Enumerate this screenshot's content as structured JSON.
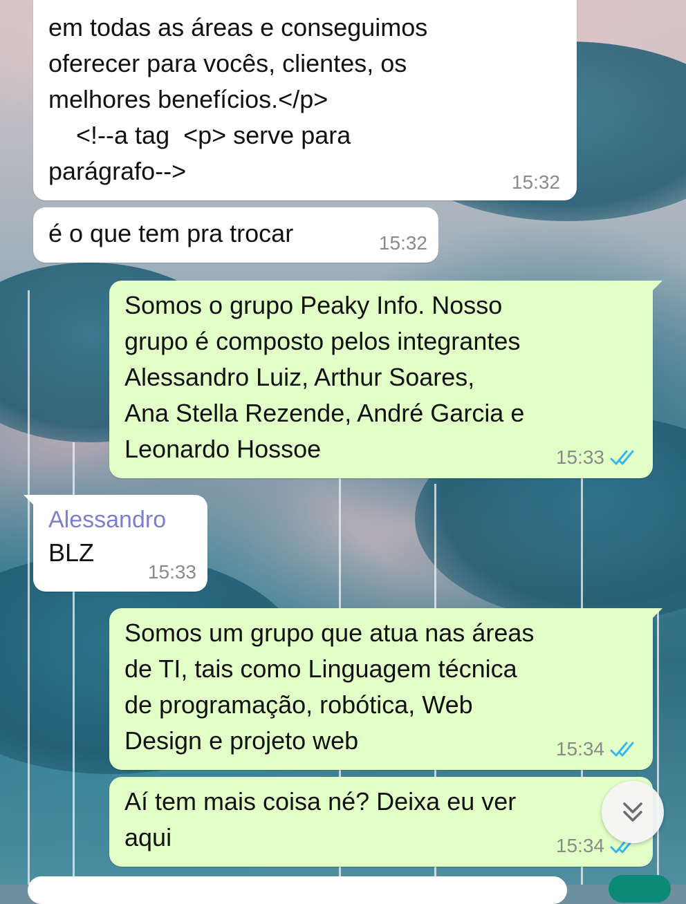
{
  "messages": [
    {
      "direction": "incoming",
      "text": "em todas as áreas e conseguimos\noferecer para vocês, clientes, os\nmelhores benefícios.</p>\n    <!--a tag  <p> serve para\nparágrafo-->",
      "time": "15:32"
    },
    {
      "direction": "incoming",
      "text": "é o que tem pra trocar",
      "time": "15:32"
    },
    {
      "direction": "outgoing",
      "text": "Somos o grupo Peaky Info. Nosso\ngrupo é composto pelos integrantes\nAlessandro Luiz, Arthur Soares,\nAna Stella Rezende, André Garcia e\nLeonardo Hossoe",
      "time": "15:33",
      "status": "read"
    },
    {
      "direction": "incoming",
      "sender": "Alessandro",
      "text": "BLZ",
      "time": "15:33"
    },
    {
      "direction": "outgoing",
      "text": "Somos um grupo que atua nas áreas\nde TI, tais como Linguagem técnica\nde programação, robótica, Web\nDesign e projeto web",
      "time": "15:34",
      "status": "read"
    },
    {
      "direction": "outgoing",
      "text": "Aí tem mais coisa né? Deixa eu ver\naqui",
      "time": "15:34",
      "status": "read"
    }
  ],
  "colors": {
    "incoming_bubble": "#ffffff",
    "outgoing_bubble": "#e2ffc7",
    "read_ticks": "#34b7f1",
    "sender_name": "#7b7fd0",
    "timestamp": "#8a8a8a"
  },
  "icons": {
    "read_receipt": "double-check-icon",
    "scroll_down": "chevron-down-double-icon"
  }
}
